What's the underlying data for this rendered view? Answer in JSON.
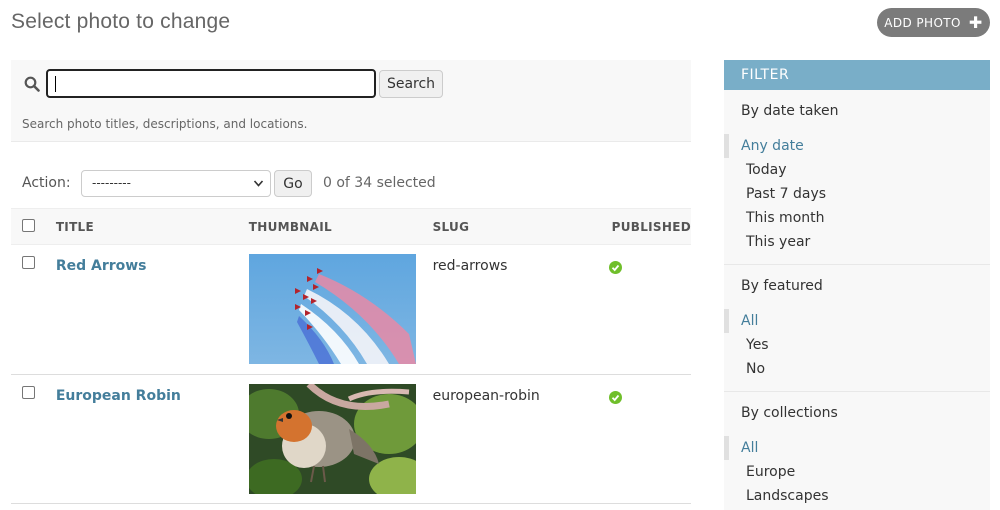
{
  "page": {
    "title": "Select photo to change"
  },
  "add_button": {
    "label": "ADD PHOTO"
  },
  "search": {
    "value": "",
    "button_label": "Search",
    "help": "Search photo titles, descriptions, and locations."
  },
  "actions": {
    "label": "Action:",
    "selected_option": "---------",
    "go_label": "Go",
    "counter": "0 of 34 selected"
  },
  "table": {
    "columns": [
      "TITLE",
      "THUMBNAIL",
      "SLUG",
      "PUBLISHED"
    ],
    "rows": [
      {
        "title": "Red Arrows",
        "thumbnail_icon": "red-arrows-photo",
        "slug": "red-arrows",
        "published": true
      },
      {
        "title": "European Robin",
        "thumbnail_icon": "european-robin-photo",
        "slug": "european-robin",
        "published": true
      }
    ]
  },
  "filter": {
    "header": "FILTER",
    "groups": [
      {
        "title": "By date taken",
        "items": [
          "Any date",
          "Today",
          "Past 7 days",
          "This month",
          "This year"
        ],
        "selected": 0
      },
      {
        "title": "By featured",
        "items": [
          "All",
          "Yes",
          "No"
        ],
        "selected": 0
      },
      {
        "title": "By collections",
        "items": [
          "All",
          "Europe",
          "Landscapes"
        ],
        "selected": 0
      }
    ]
  },
  "colors": {
    "link": "#447e9b",
    "filter_header": "#79aec8",
    "published_ok": "#70bf2b",
    "add_button": "#7b7b7b"
  }
}
